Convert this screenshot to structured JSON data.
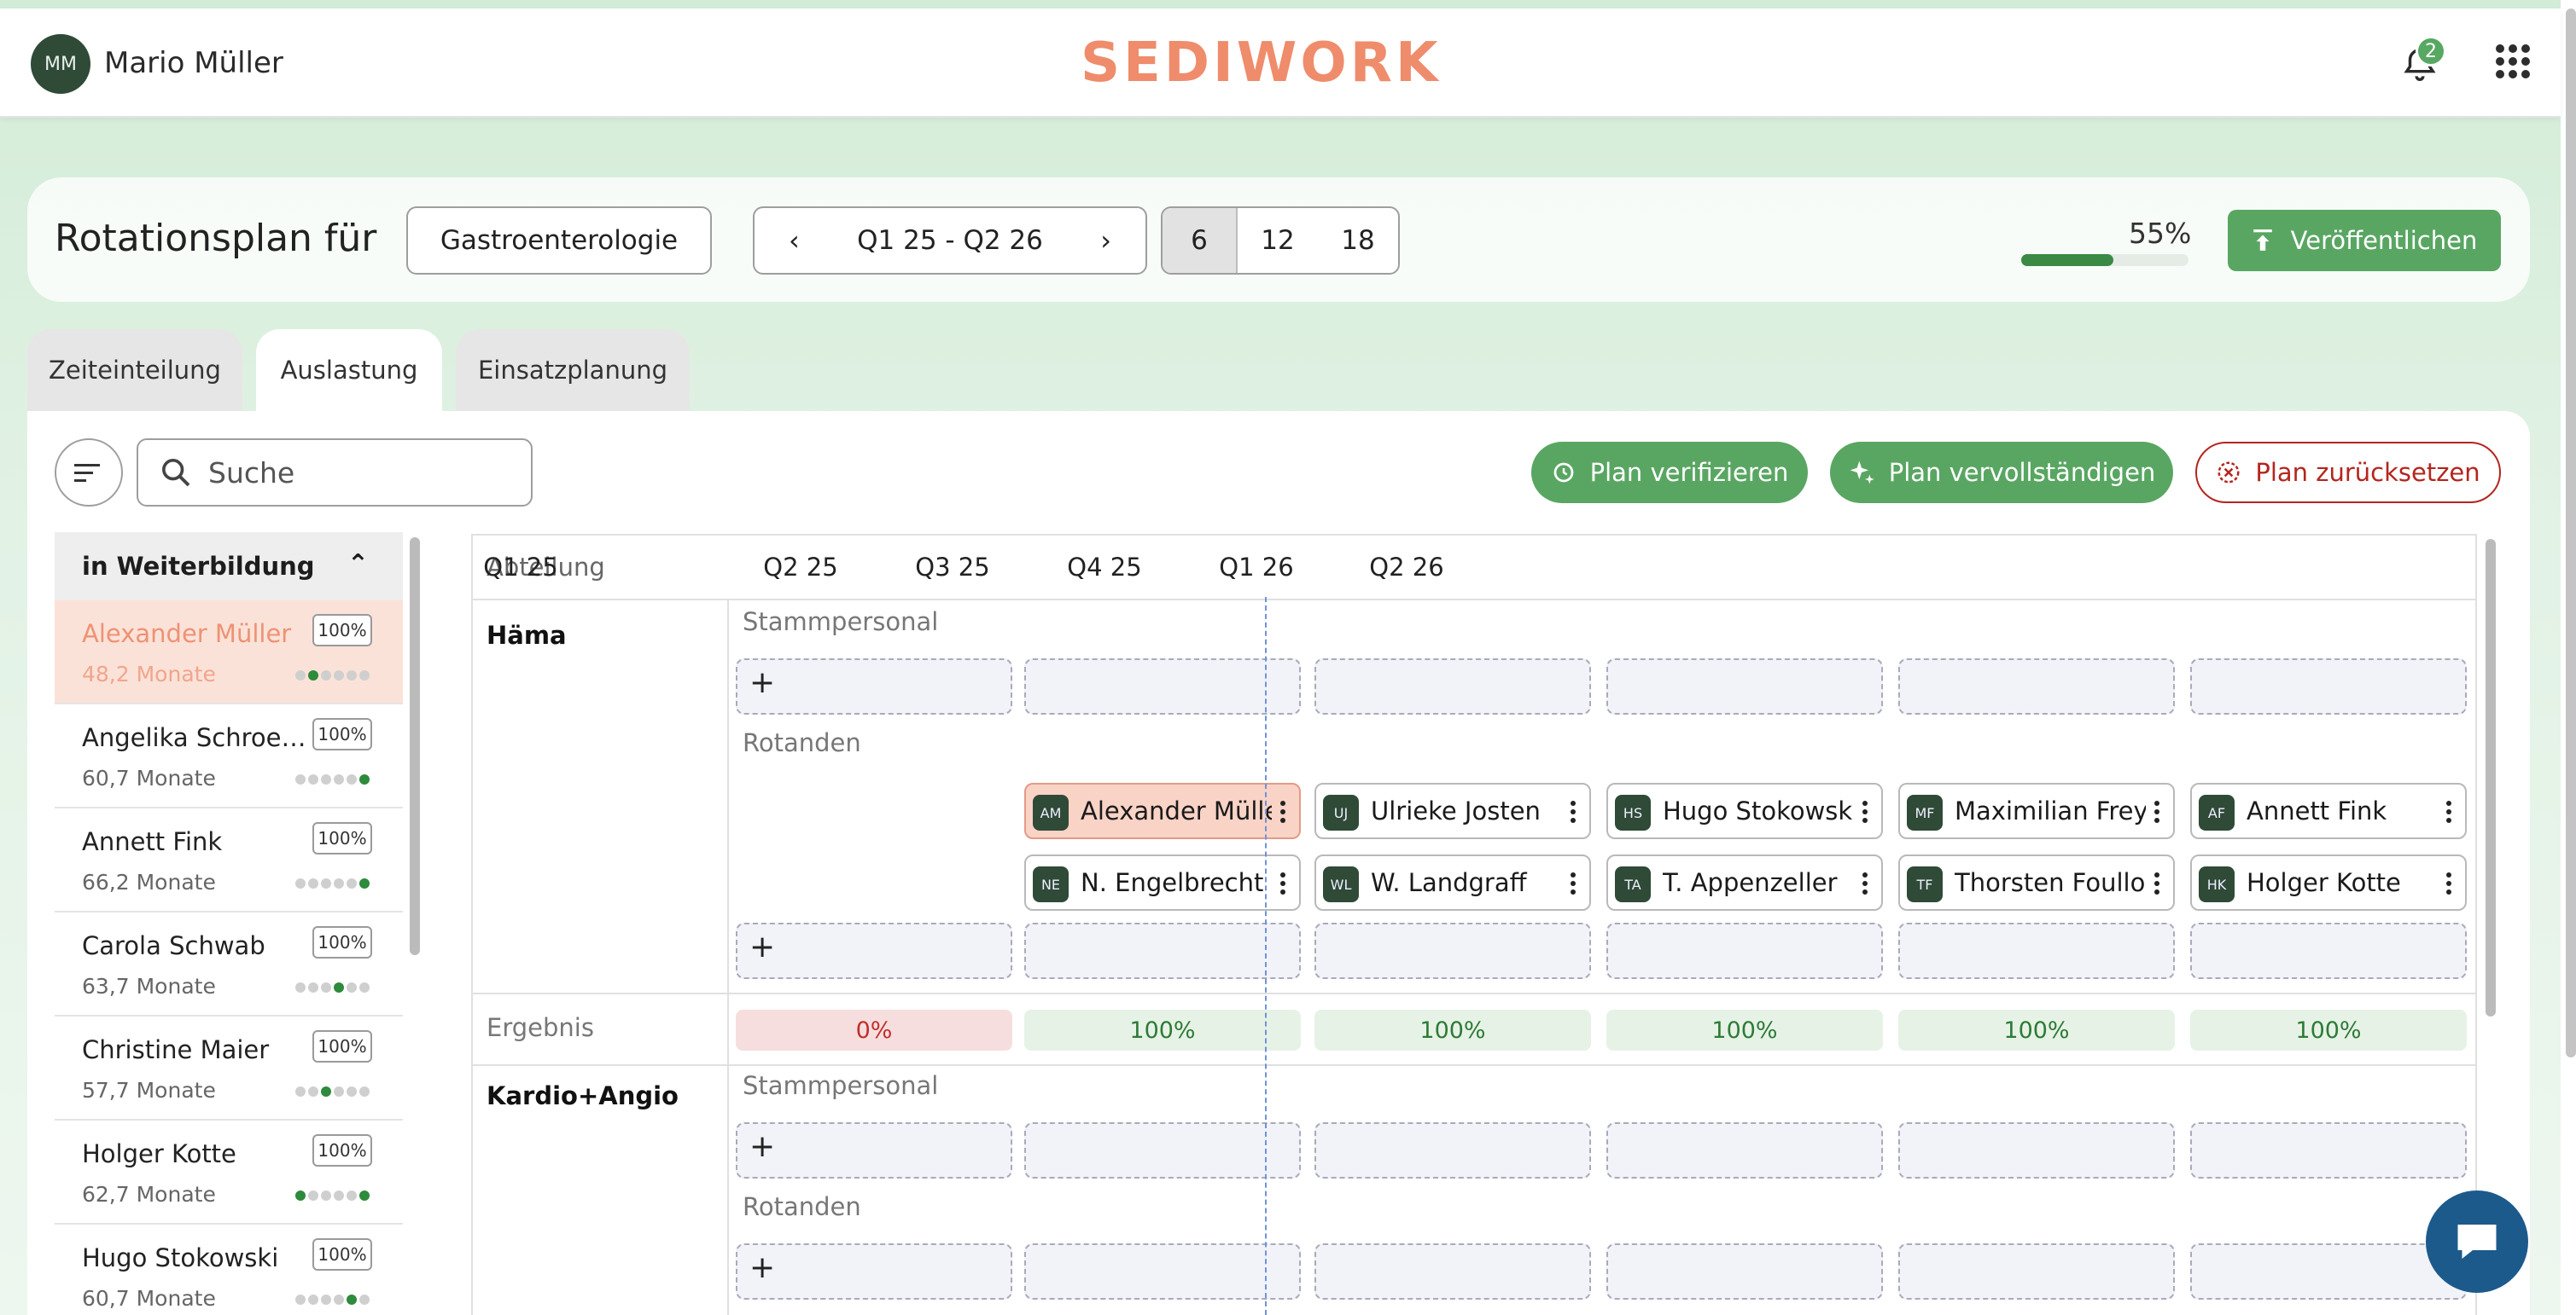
{
  "header": {
    "user_initials": "MM",
    "user_name": "Mario Müller",
    "logo_text": "SEDIWORK",
    "notifications_count": "2"
  },
  "plan": {
    "title": "Rotationsplan für",
    "department": "Gastroenterologie",
    "period": "Q1 25 - Q2 26",
    "span_options": [
      "6",
      "12",
      "18"
    ],
    "span_selected": "6",
    "progress_label": "55%",
    "progress_value": 0.55,
    "publish_label": "Veröffentlichen"
  },
  "tabs": [
    "Zeiteinteilung",
    "Auslastung",
    "Einsatzplanung"
  ],
  "active_tab": "Auslastung",
  "toolbar": {
    "search_placeholder": "Suche",
    "verify_label": "Plan verifizieren",
    "complete_label": "Plan vervollständigen",
    "reset_label": "Plan zurücksetzen"
  },
  "sidebar": {
    "group_title": "in Weiterbildung",
    "items": [
      {
        "name": "Alexander Müller",
        "months": "48,2 Monate",
        "pct": "100%"
      },
      {
        "name": "Angelika Schroe…",
        "months": "60,7 Monate",
        "pct": "100%"
      },
      {
        "name": "Annett Fink",
        "months": "66,2 Monate",
        "pct": "100%"
      },
      {
        "name": "Carola Schwab",
        "months": "63,7 Monate",
        "pct": "100%"
      },
      {
        "name": "Christine Maier",
        "months": "57,7 Monate",
        "pct": "100%"
      },
      {
        "name": "Holger Kotte",
        "months": "62,7 Monate",
        "pct": "100%"
      },
      {
        "name": "Hugo Stokowski",
        "months": "60,7 Monate",
        "pct": "100%"
      }
    ]
  },
  "grid": {
    "dept_header": "Abteilung",
    "quarters": [
      "Q1 25",
      "Q2 25",
      "Q3 25",
      "Q4 25",
      "Q1 26",
      "Q2 26"
    ],
    "sections": [
      {
        "name": "Häma",
        "staff_label": "Stammpersonal",
        "rot_label": "Rotanden",
        "rot_row1": [
          {
            "ini": "AM",
            "name": "Alexander Müller"
          },
          {
            "ini": "UJ",
            "name": "Ulrieke Josten"
          },
          {
            "ini": "HS",
            "name": "Hugo Stokowski"
          },
          {
            "ini": "MF",
            "name": "Maximilian Frey"
          },
          {
            "ini": "AF",
            "name": "Annett Fink"
          }
        ],
        "rot_row2": [
          {
            "ini": "NE",
            "name": "N. Engelbrecht"
          },
          {
            "ini": "WL",
            "name": "W. Landgraff"
          },
          {
            "ini": "TA",
            "name": "T. Appenzeller"
          },
          {
            "ini": "TF",
            "name": "Thorsten Foulloi"
          },
          {
            "ini": "HK",
            "name": "Holger Kotte"
          }
        ],
        "result_label": "Ergebnis",
        "results": [
          "0%",
          "100%",
          "100%",
          "100%",
          "100%",
          "100%"
        ]
      },
      {
        "name": "Kardio+Angio",
        "staff_label": "Stammpersonal",
        "rot_label": "Rotanden"
      }
    ],
    "add_symbol": "+"
  }
}
